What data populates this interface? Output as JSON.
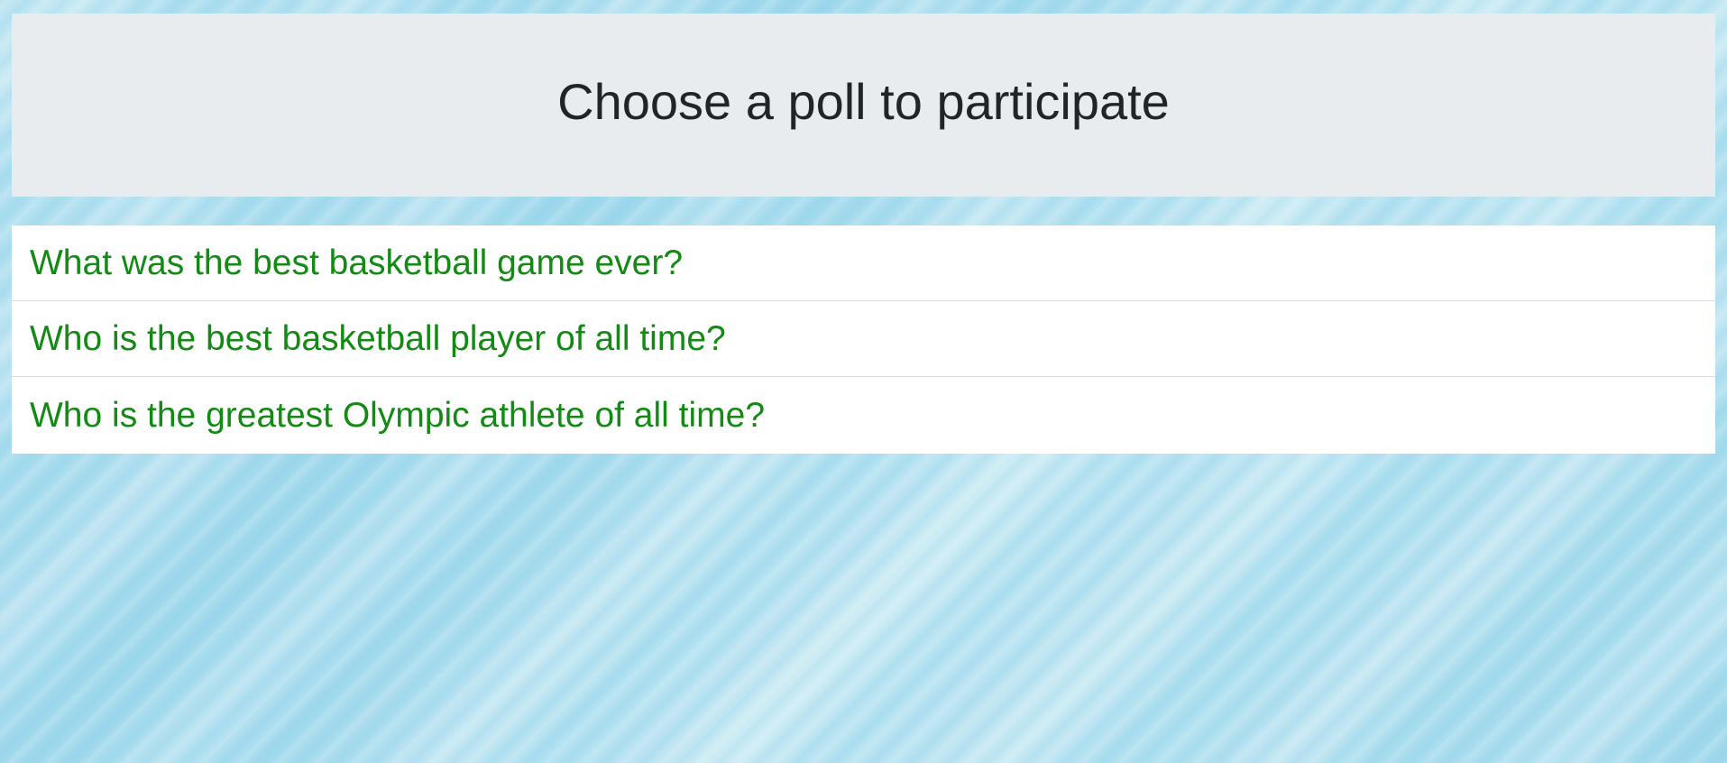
{
  "header": {
    "title": "Choose a poll to participate"
  },
  "polls": [
    {
      "question": "What was the best basketball game ever?"
    },
    {
      "question": "Who is the best basketball player of all time?"
    },
    {
      "question": "Who is the greatest Olympic athlete of all time?"
    }
  ],
  "colors": {
    "link": "#138a13",
    "header_bg": "#e8ecef",
    "title_text": "#212529",
    "page_bg": "#aadcee"
  }
}
